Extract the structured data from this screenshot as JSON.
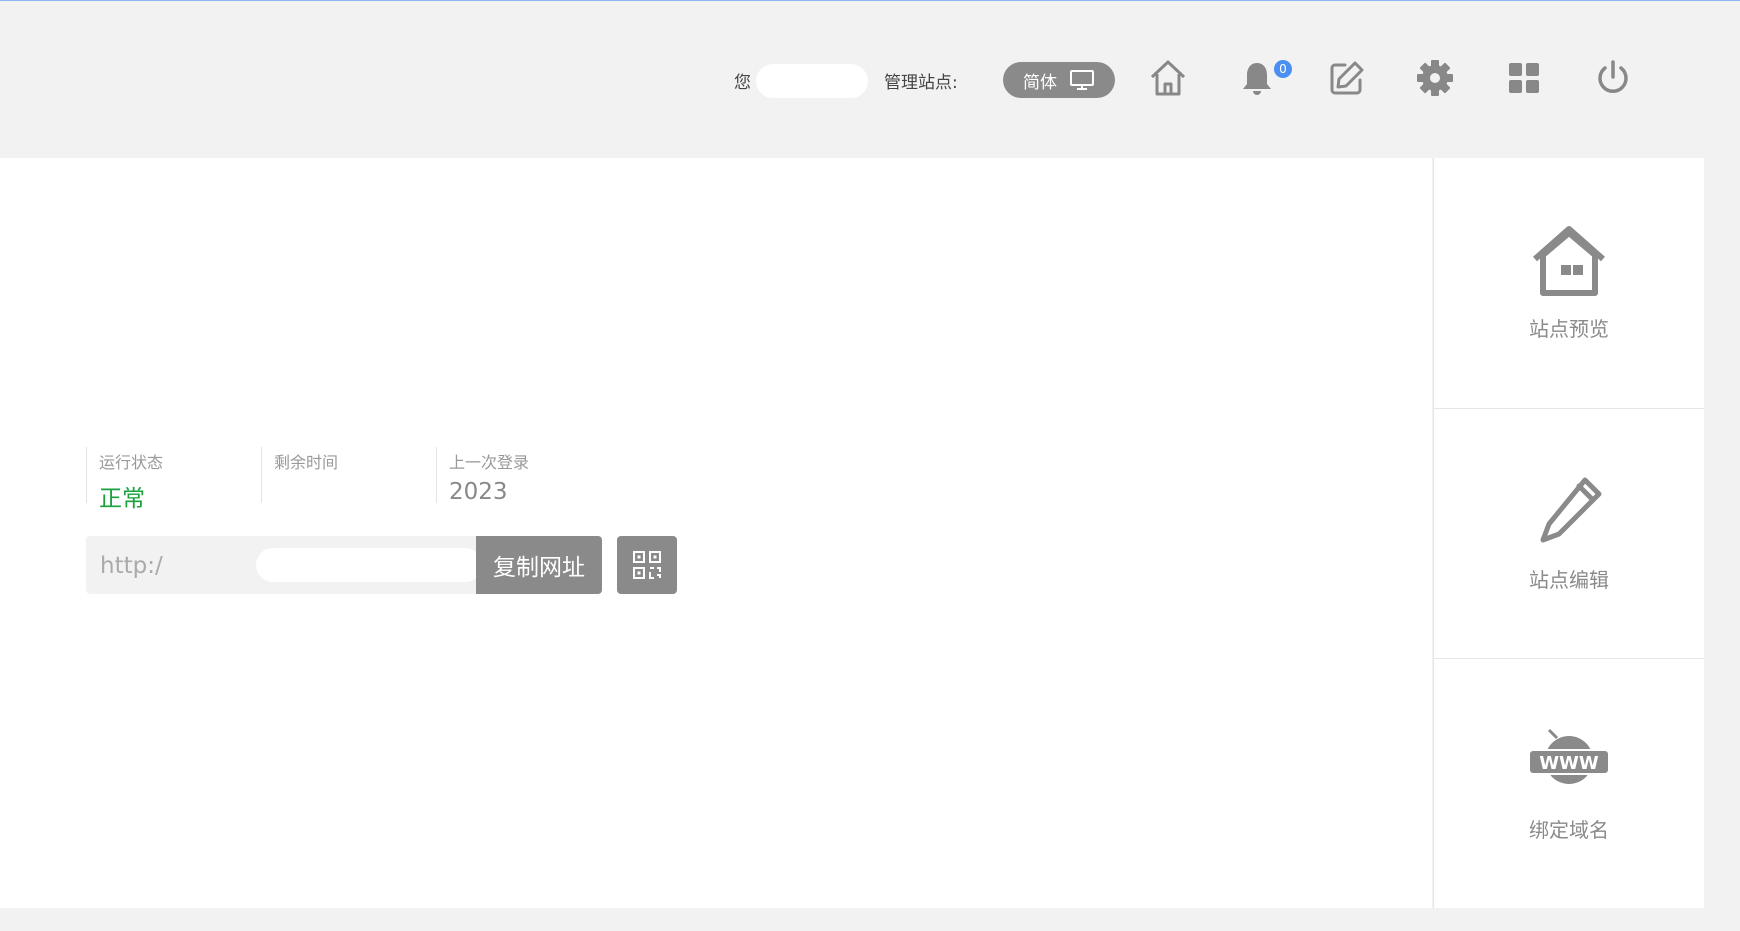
{
  "header": {
    "greeting": "您",
    "site_label": "管理站点:",
    "language": "简体",
    "notification_count": "0",
    "icons": [
      "home-icon",
      "bell-icon",
      "edit-icon",
      "gear-icon",
      "apps-grid-icon",
      "power-icon"
    ]
  },
  "status": {
    "run_label": "运行状态",
    "run_value": "正常",
    "remaining_label": "剩余时间",
    "remaining_value": "",
    "last_login_label": "上一次登录",
    "last_login_value": "2023"
  },
  "url": {
    "value": "http:/",
    "copy_label": "复制网址"
  },
  "sidebar": {
    "items": [
      {
        "label": "站点预览",
        "icon": "house-icon"
      },
      {
        "label": "站点编辑",
        "icon": "pencil-icon"
      },
      {
        "label": "绑定域名",
        "icon": "www-globe-icon"
      }
    ]
  },
  "colors": {
    "accent_gray": "#8a8a8a",
    "status_ok": "#19a23c",
    "badge_blue": "#4c8ff3",
    "background": "#f2f2f2"
  }
}
